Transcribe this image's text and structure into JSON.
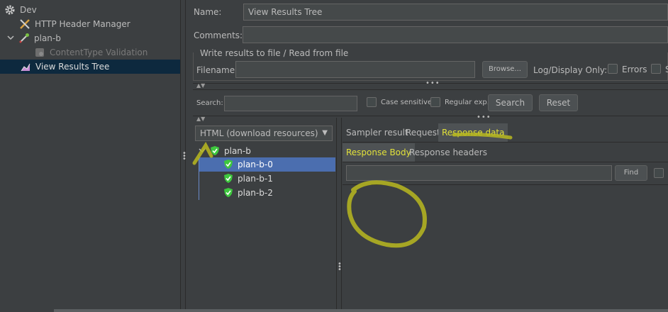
{
  "tree": {
    "items": [
      {
        "label": "Dev",
        "icon": "gear-icon",
        "expanded": true
      },
      {
        "label": "HTTP Header Manager",
        "icon": "tools-icon"
      },
      {
        "label": "plan-b",
        "icon": "dropper-icon",
        "expanded": true
      },
      {
        "label": "ContentType Validation",
        "icon": "assertion-icon",
        "disabled": true
      },
      {
        "label": "View Results Tree",
        "icon": "chart-icon",
        "selected": true
      }
    ]
  },
  "form": {
    "name_label": "Name:",
    "name_value": "View Results Tree",
    "comments_label": "Comments:",
    "comments_value": "",
    "file_group_title": "Write results to file / Read from file",
    "filename_label": "Filename",
    "filename_value": "",
    "browse_label": "Browse...",
    "log_display_label": "Log/Display Only:",
    "errors_label": "Errors",
    "successes_label": "S"
  },
  "search": {
    "label": "Search:",
    "value": "",
    "case_sensitive_label": "Case sensitive",
    "regex_label": "Regular exp.",
    "search_button": "Search",
    "reset_button": "Reset"
  },
  "renderer": {
    "selected": "HTML (download resources)"
  },
  "results": {
    "root": "plan-b",
    "samples": [
      "plan-b-0",
      "plan-b-1",
      "plan-b-2"
    ],
    "selected_index": 0
  },
  "tabs": {
    "main": [
      {
        "label": "Sampler result"
      },
      {
        "label": "Request"
      },
      {
        "label": "Response data",
        "active": true
      }
    ],
    "sub": [
      {
        "label": "Response Body",
        "active": true
      },
      {
        "label": "Response headers"
      }
    ]
  },
  "find": {
    "value": "",
    "button": "Find"
  },
  "colors": {
    "background": "#3c3f41",
    "selection": "#0d293e",
    "result_selection": "#4b6eaf",
    "highlight": "#e1e13a",
    "success_green": "#3ec83e"
  }
}
